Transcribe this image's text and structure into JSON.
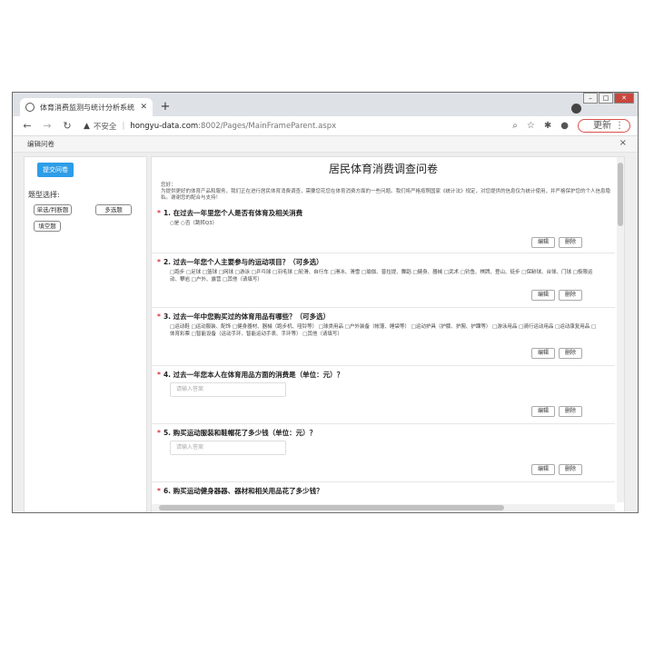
{
  "browser": {
    "tab_title": "体育消费监测与统计分析系统",
    "address_warning": "不安全",
    "url_host": "hongyu-data.com",
    "url_path": ":8002/Pages/MainFrameParent.aspx",
    "update_label": "更新"
  },
  "app": {
    "header_title": "编辑问卷",
    "submit_label": "提交问卷",
    "question_type_label": "题型选择:",
    "question_types": [
      "单选/判断题",
      "多选题",
      "填空题"
    ]
  },
  "form": {
    "title": "居民体育消费调查问卷",
    "intro": "您好：\n为提供更好的体育产品和服务，我们正在进行居民体育消费调查，需要您花您在体育消费方面的一些问题。我们将严格按照国家《统计法》规定，对您提供的信息仅为统计使用，并严格保护您的个人信息隐私。谢谢您的配合与支持！",
    "edit_label": "编辑",
    "delete_label": "删除",
    "questions": [
      {
        "title": "1. 在过去一年里您个人是否有体育及相关消费",
        "options": "○是 ○否（跳转Q3）"
      },
      {
        "title": "2. 过去一年您个人主要参与的运动项目？（可多选）",
        "options": "□跑步 □足球 □篮球 □网球 □游泳 □乒乓球 □羽毛球 □轮滑、自行车 □滑冰、滑雪 □瑜伽、普拉提、舞蹈 □健身、器械 □武术 □钓鱼、棋牌、登山、徒步 □保龄球、台球、门球 □极限运动、攀岩 □户外、露营 □其他（请填写）"
      },
      {
        "title": "3. 过去一年中您购买过的体育用品有哪些？（可多选）",
        "options": "□运动鞋 □运动服装、配饰 □健身器材、器械（跑步机、哑铃等） □球类用品 □户外装备（帐篷、睡袋等） □运动护具（护膝、护腕、护踝等） □游泳用品 □骑行运动用品 □运动康复用品 □体育彩票 □智能设备（运动手环、智能运动手表、手环等） □其他（请填写）"
      },
      {
        "title": "4. 过去一年您本人在体育用品方面的消费是（单位：元）？",
        "placeholder": "请输入答案"
      },
      {
        "title": "5. 购买运动服装和鞋帽花了多少钱（单位：元）？",
        "placeholder": "请输入答案"
      },
      {
        "title": "6. 购买运动健身器器、器材和相关用品花了多少钱？"
      }
    ]
  }
}
